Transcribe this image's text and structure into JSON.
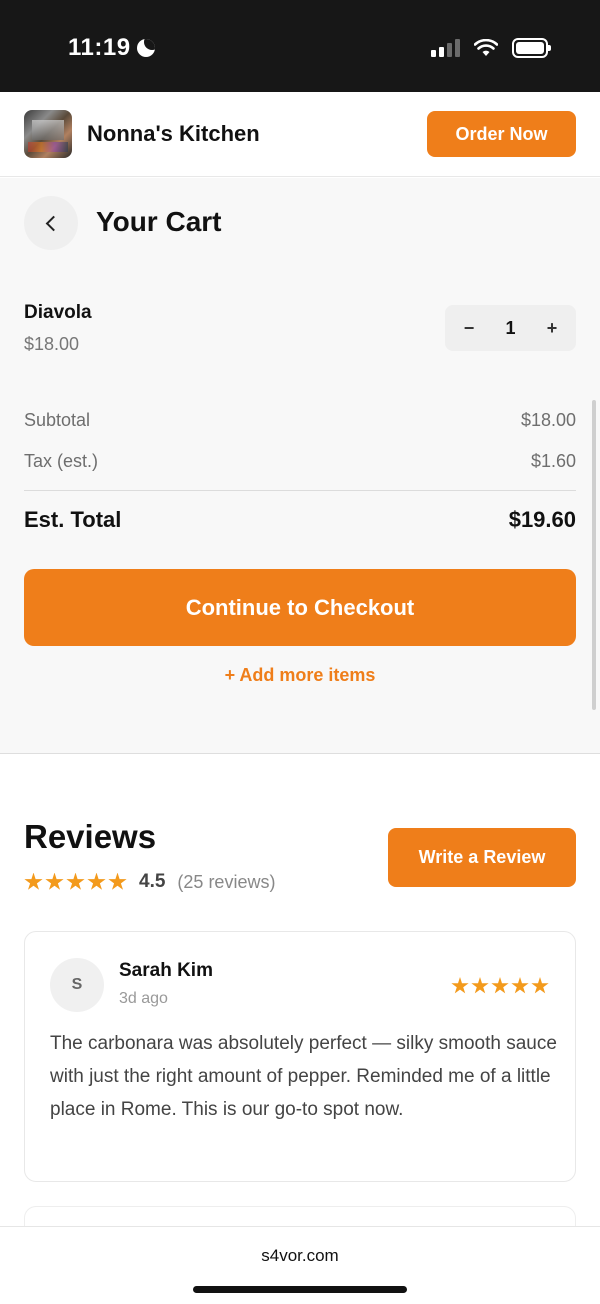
{
  "status_bar": {
    "time": "11:19"
  },
  "header": {
    "brand_name": "Nonna's Kitchen",
    "order_button": "Order Now"
  },
  "cart": {
    "title": "Your Cart",
    "items": [
      {
        "name": "Diavola",
        "price": "$18.00",
        "quantity": "1"
      }
    ],
    "stepper": {
      "minus": "−",
      "plus": "+"
    },
    "subtotal_label": "Subtotal",
    "subtotal_value": "$18.00",
    "tax_label": "Tax (est.)",
    "tax_value": "$1.60",
    "total_label": "Est. Total",
    "total_value": "$19.60",
    "checkout_button": "Continue to Checkout",
    "add_more_link": "+ Add more items"
  },
  "reviews": {
    "title": "Reviews",
    "average_rating": "4.5",
    "rating_stars": 5,
    "review_count": "(25 reviews)",
    "write_button": "Write a Review",
    "list": [
      {
        "avatar_initial": "S",
        "name": "Sarah Kim",
        "time": "3d ago",
        "stars": 5,
        "text": "The carbonara was absolutely perfect — silky smooth sauce with just the right amount of pepper. Reminded me of a little place in Rome. This is our go-to spot now."
      }
    ]
  },
  "browser": {
    "url": "s4vor.com"
  },
  "colors": {
    "accent": "#ef7e1a",
    "star": "#f39a1c",
    "status_bar": "#171717"
  }
}
